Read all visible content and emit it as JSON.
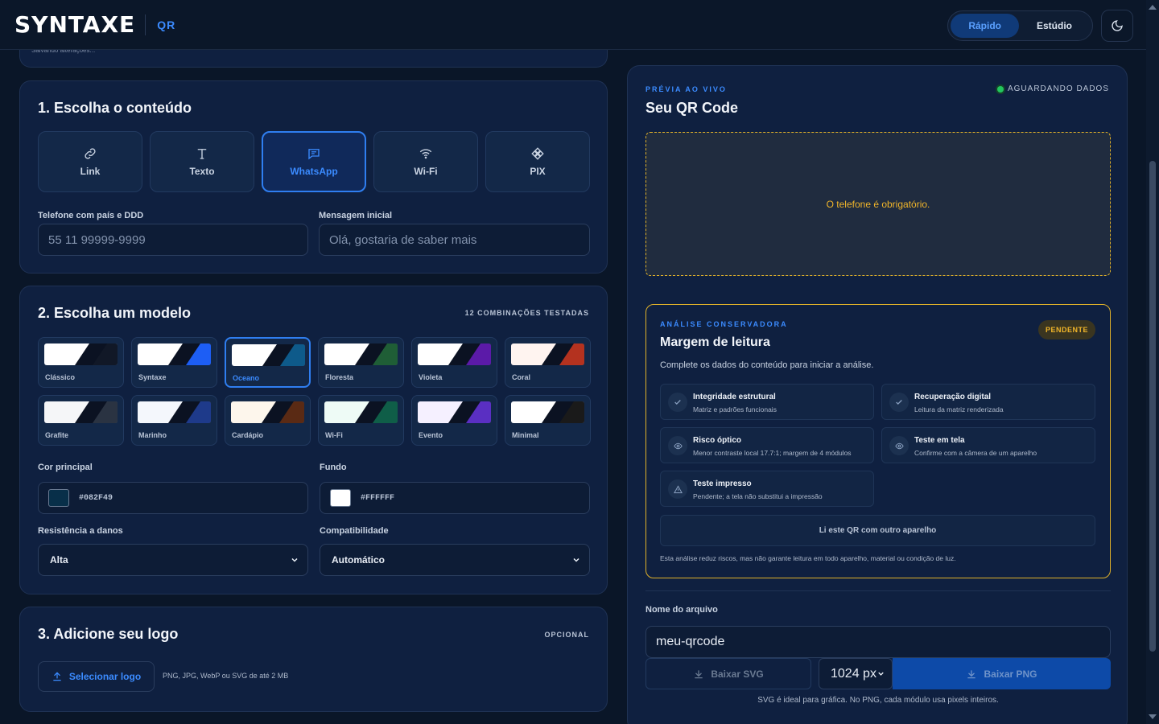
{
  "header": {
    "brand": "SYNTAXE",
    "product": "QR",
    "modes": [
      {
        "label": "Rápido",
        "active": true
      },
      {
        "label": "Estúdio",
        "active": false
      }
    ]
  },
  "saving_note": "Salvando alterações...",
  "content_section": {
    "title": "1. Escolha o conteúdo",
    "types": [
      {
        "label": "Link",
        "icon": "link-icon"
      },
      {
        "label": "Texto",
        "icon": "text-icon"
      },
      {
        "label": "WhatsApp",
        "icon": "chat-icon",
        "active": true
      },
      {
        "label": "Wi-Fi",
        "icon": "wifi-icon"
      },
      {
        "label": "PIX",
        "icon": "pix-icon"
      }
    ],
    "phone": {
      "label": "Telefone com país e DDD",
      "placeholder": "55 11 99999-9999",
      "value": ""
    },
    "message": {
      "label": "Mensagem inicial",
      "placeholder": "Olá, gostaria de saber mais",
      "value": ""
    }
  },
  "template_section": {
    "title": "2. Escolha um modelo",
    "tag": "12 COMBINAÇÕES TESTADAS",
    "templates": [
      {
        "name": "Clássico",
        "fg": "#111827",
        "bg": "#ffffff"
      },
      {
        "name": "Syntaxe",
        "fg": "#1d5ef5",
        "bg": "#ffffff"
      },
      {
        "name": "Oceano",
        "fg": "#0e5a8a",
        "bg": "#ffffff",
        "active": true
      },
      {
        "name": "Floresta",
        "fg": "#1f5e36",
        "bg": "#ffffff"
      },
      {
        "name": "Violeta",
        "fg": "#5b1aa8",
        "bg": "#ffffff"
      },
      {
        "name": "Coral",
        "fg": "#b4321f",
        "bg": "#fff4f0"
      },
      {
        "name": "Grafite",
        "fg": "#2a3342",
        "bg": "#f5f6f8"
      },
      {
        "name": "Marinho",
        "fg": "#1e3a8a",
        "bg": "#f4f7fc"
      },
      {
        "name": "Cardápio",
        "fg": "#5a2a14",
        "bg": "#fdf6ec"
      },
      {
        "name": "Wi-Fi",
        "fg": "#0f5e48",
        "bg": "#eefbf6"
      },
      {
        "name": "Evento",
        "fg": "#5a2fc2",
        "bg": "#f5f0ff"
      },
      {
        "name": "Minimal",
        "fg": "#1a1a1a",
        "bg": "#ffffff"
      }
    ],
    "main_color": {
      "label": "Cor principal",
      "value": "#082F49"
    },
    "background": {
      "label": "Fundo",
      "value": "#FFFFFF"
    },
    "damage": {
      "label": "Resistência a danos",
      "value": "Alta"
    },
    "compat": {
      "label": "Compatibilidade",
      "value": "Automático"
    }
  },
  "logo_section": {
    "title": "3. Adicione seu logo",
    "tag": "OPCIONAL",
    "button": "Selecionar logo",
    "hint": "PNG, JPG, WebP ou SVG de até 2 MB"
  },
  "preview": {
    "eyebrow": "PRÉVIA AO VIVO",
    "title": "Seu QR Code",
    "status": "AGUARDANDO DADOS",
    "message": "O telefone é obrigatório."
  },
  "analysis": {
    "eyebrow": "ANÁLISE CONSERVADORA",
    "title": "Margem de leitura",
    "badge": "PENDENTE",
    "intro": "Complete os dados do conteúdo para iniciar a análise.",
    "checks": [
      {
        "title": "Integridade estrutural",
        "desc": "Matriz e padrões funcionais",
        "icon": "check-icon"
      },
      {
        "title": "Recuperação digital",
        "desc": "Leitura da matriz renderizada",
        "icon": "check-icon"
      },
      {
        "title": "Risco óptico",
        "desc": "Menor contraste local 17.7:1; margem de 4 módulos",
        "icon": "eye-icon"
      },
      {
        "title": "Teste em tela",
        "desc": "Confirme com a câmera de um aparelho",
        "icon": "eye-icon"
      },
      {
        "title": "Teste impresso",
        "desc": "Pendente; a tela não substitui a impressão",
        "icon": "warning-icon"
      }
    ],
    "other_device": "Li este QR com outro aparelho",
    "disclaimer": "Esta análise reduz riscos, mas não garante leitura em todo aparelho, material ou condição de luz."
  },
  "export": {
    "filename_label": "Nome do arquivo",
    "filename_value": "meu-qrcode",
    "svg_button": "Baixar SVG",
    "size_value": "1024 px",
    "png_button": "Baixar PNG",
    "note": "SVG é ideal para gráfica. No PNG, cada módulo usa pixels inteiros."
  }
}
